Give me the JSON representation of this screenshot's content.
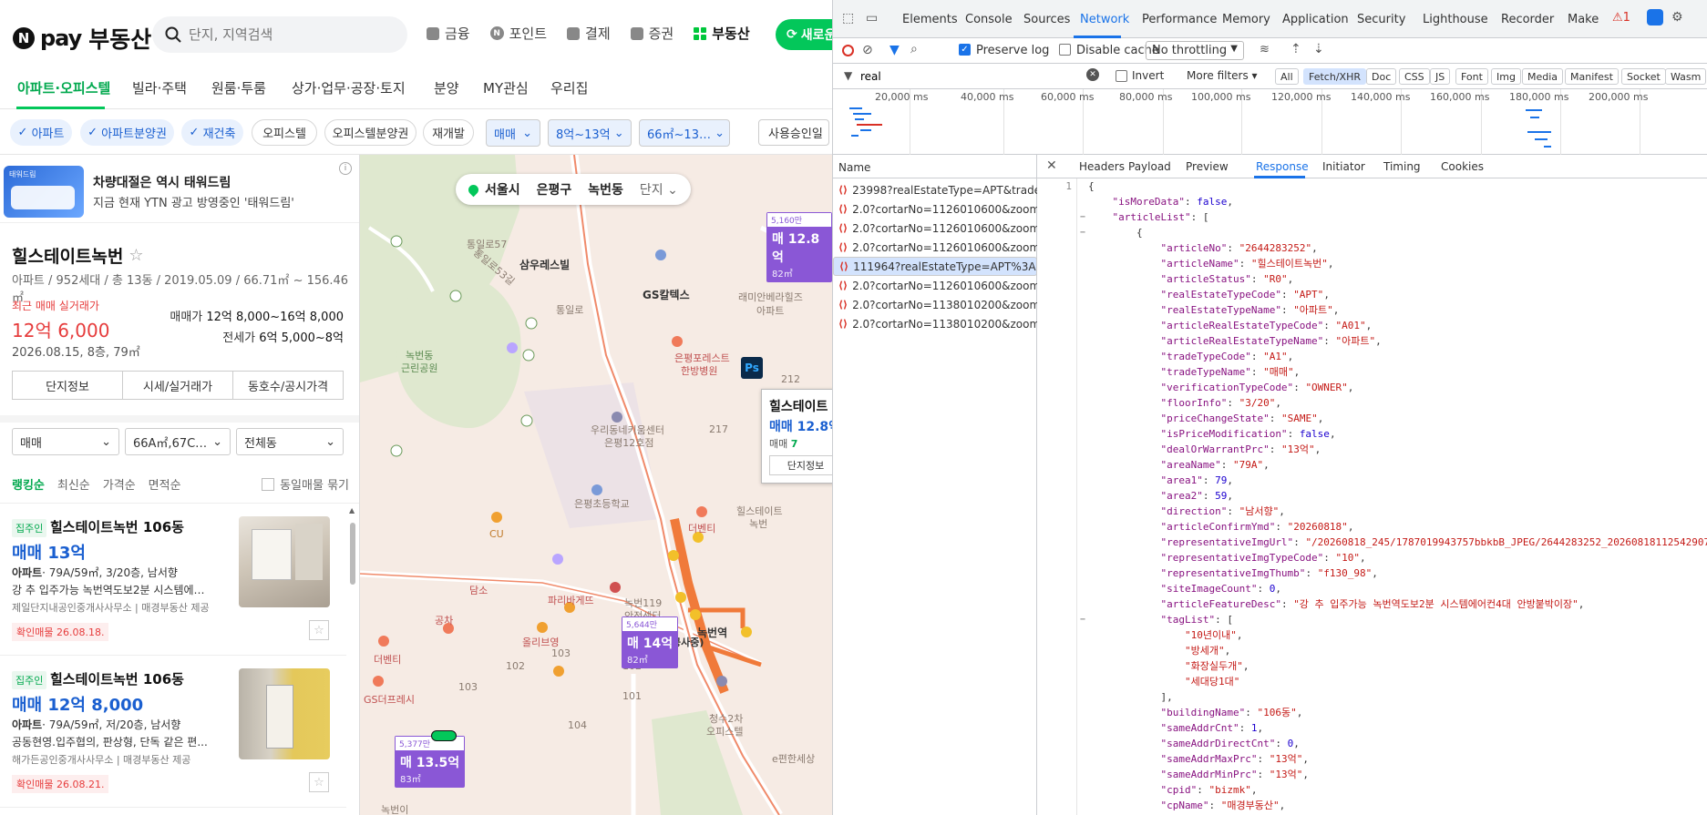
{
  "header": {
    "logo_pay": "pay",
    "logo_re": "부동산",
    "search_placeholder": "단지, 지역검색",
    "nav": [
      "금융",
      "포인트",
      "결제",
      "증권",
      "부동산"
    ],
    "new_btn": "새로운"
  },
  "subnav": [
    "아파트·오피스텔",
    "빌라·주택",
    "원룸·투룸",
    "상가·업무·공장·토지",
    "분양",
    "MY관심",
    "우리집"
  ],
  "filters": {
    "chips_on": [
      "아파트",
      "아파트분양권",
      "재건축"
    ],
    "chips_off": [
      "오피스텔",
      "오피스텔분양권",
      "재개발"
    ],
    "trade": "매매",
    "price": "8억~13억",
    "area": "66㎡~13…",
    "approval": "사용승인일"
  },
  "ad": {
    "title": "차량대절은 역시 태워드림",
    "text": "지금 현재 YTN 광고 방영중인 '태워드림'",
    "info": "i",
    "thumb": "태워드림"
  },
  "complex": {
    "name": "힐스테이트녹번",
    "meta": "아파트 / 952세대 / 총 13동 / 2019.05.09 / 66.71㎡ ~ 156.46㎡",
    "recent_label": "최근 매매 실거래가",
    "recent_price": "12억 6,000",
    "recent_date": "2026.08.15, 8층, 79㎡",
    "sale_label": "매매가",
    "sale_range": "12억 8,000~16억 8,000",
    "jeonse_label": "전세가",
    "jeonse_range": "6억 5,000~8억",
    "tabs": [
      "단지정보",
      "시세/실거래가",
      "동호수/공시가격"
    ]
  },
  "list_filters": {
    "trade": "매매",
    "area": "66A㎡,67C…",
    "dong": "전체동"
  },
  "sort": {
    "items": [
      "랭킹순",
      "최신순",
      "가격순",
      "면적순"
    ],
    "same_group": "동일매물 묶기"
  },
  "listings": [
    {
      "badge": "집주인",
      "title": "힐스테이트녹번 106동",
      "price": "매매 13억",
      "type": "아파트",
      "spec": "· 79A/59㎡, 3/20층, 남서향",
      "desc": "강 추 입주가능 녹번역도보2분 시스템에어...",
      "agent1": "제일단지내공인중개사사무소",
      "agent2": "매경부동산 제공",
      "confirm": "확인매물 26.08.18."
    },
    {
      "badge": "집주인",
      "title": "힐스테이트녹번 106동",
      "price": "매매 12억 8,000",
      "type": "아파트",
      "spec": "· 79A/59㎡, 저/20층, 남서향",
      "desc": "공동현영.입주협의, 판상형, 단독 같은 편...",
      "agent1": "해가든공인중개사사무소",
      "agent2": "매경부동산 제공",
      "confirm": "확인매물 26.08.21."
    }
  ],
  "map": {
    "loc": [
      "서울시",
      "은평구",
      "녹번동",
      "단지"
    ],
    "markers": [
      {
        "top": "5,160만",
        "price": "매 12.8억",
        "area": "82㎡"
      },
      {
        "top": "5,644만",
        "price": "매 14억",
        "area": "82㎡"
      },
      {
        "top": "5,377만",
        "price": "매 13.5억",
        "area": "83㎡"
      }
    ],
    "labels": [
      "통일로57",
      "삼우레스빌",
      "통일로",
      "GS칼텍스",
      "래미안베라힐즈",
      "아파트",
      "녹번동",
      "근린공원",
      "은평포레스트",
      "한방병원",
      "우리동네키움센터",
      "은평12호점",
      "은평초등학교",
      "CU",
      "힐스테이트",
      "녹번",
      "더벤티",
      "담소",
      "파리바게뜨",
      "녹번119",
      "안전센터",
      "녹번역",
      "(공사중)",
      "공차",
      "올리브영",
      "더벤티",
      "GS더프레시",
      "청수2차",
      "오피스텔",
      "녹번이",
      "e편한세상",
      "통일로53길",
      "217",
      "212",
      "212",
      "103",
      "103",
      "102",
      "101",
      "104",
      "102"
    ],
    "popup": {
      "title": "힐스테이트",
      "price": "매매 12.8억",
      "count_label": "매매",
      "count": "7",
      "btn": "단지정보"
    },
    "ps": "Ps"
  },
  "devtools": {
    "tabs": [
      "Elements",
      "Console",
      "Sources",
      "Network",
      "Performance",
      "Memory",
      "Application",
      "Security",
      "Lighthouse",
      "Recorder",
      "Make"
    ],
    "warn": "1",
    "toolbar": {
      "preserve": "Preserve log",
      "disable": "Disable cache",
      "throttle": "No throttling"
    },
    "filter": {
      "value": "real",
      "invert": "Invert",
      "more": "More filters",
      "types": [
        "All",
        "Fetch/XHR",
        "Doc",
        "CSS",
        "JS",
        "Font",
        "Img",
        "Media",
        "Manifest",
        "Socket",
        "Wasm"
      ]
    },
    "timeline": [
      "20,000 ms",
      "40,000 ms",
      "60,000 ms",
      "80,000 ms",
      "100,000 ms",
      "120,000 ms",
      "140,000 ms",
      "160,000 ms",
      "180,000 ms",
      "200,000 ms"
    ],
    "name_header": "Name",
    "requests": [
      "23998?realEstateType=APT&trade...",
      "2.0?cortarNo=1126010600&zoom...",
      "2.0?cortarNo=1126010600&zoom...",
      "2.0?cortarNo=1126010600&zoom...",
      "111964?realEstateType=APT%3AA...",
      "2.0?cortarNo=1126010600&zoom...",
      "2.0?cortarNo=1138010200&zoom...",
      "2.0?cortarNo=1138010200&zoom..."
    ],
    "detail_tabs": [
      "Headers",
      "Payload",
      "Preview",
      "Response",
      "Initiator",
      "Timing",
      "Cookies"
    ],
    "lines": [
      "{",
      "    \"isMoreData\": false,",
      "    \"articleList\": [",
      "        {",
      "            \"articleNo\": \"2644283252\",",
      "            \"articleName\": \"힐스테이트녹번\",",
      "            \"articleStatus\": \"R0\",",
      "            \"realEstateTypeCode\": \"APT\",",
      "            \"realEstateTypeName\": \"아파트\",",
      "            \"articleRealEstateTypeCode\": \"A01\",",
      "            \"articleRealEstateTypeName\": \"아파트\",",
      "            \"tradeTypeCode\": \"A1\",",
      "            \"tradeTypeName\": \"매매\",",
      "            \"verificationTypeCode\": \"OWNER\",",
      "            \"floorInfo\": \"3/20\",",
      "            \"priceChangeState\": \"SAME\",",
      "            \"isPriceModification\": false,",
      "            \"dealOrWarrantPrc\": \"13억\",",
      "            \"areaName\": \"79A\",",
      "            \"area1\": 79,",
      "            \"area2\": 59,",
      "            \"direction\": \"남서향\",",
      "            \"articleConfirmYmd\": \"20260818\",",
      "            \"representativeImgUrl\": \"/20260818_245/1787019943757bbkbB_JPEG/2644283252_20260818112542907812.jpg\",",
      "            \"representativeImgTypeCode\": \"10\",",
      "            \"representativeImgThumb\": \"f130_98\",",
      "            \"siteImageCount\": 0,",
      "            \"articleFeatureDesc\": \"강 추 입주가능 녹번역도보2분 시스템에어컨4대 안방붙박이장\",",
      "            \"tagList\": [",
      "                \"10년이내\",",
      "                \"방세개\",",
      "                \"화장실두개\",",
      "                \"세대당1대\"",
      "            ],",
      "            \"buildingName\": \"106동\",",
      "            \"sameAddrCnt\": 1,",
      "            \"sameAddrDirectCnt\": 0,",
      "            \"sameAddrMaxPrc\": \"13억\",",
      "            \"sameAddrMinPrc\": \"13억\",",
      "            \"cpid\": \"bizmk\",",
      "            \"cpName\": \"매경부동산\",",
      "            \"cpPcArticleUrl\": \"http://land.mk.co.kr/rd/rd.php?UID=2644283252\","
    ],
    "line_no": "1",
    "colors": {
      "accent": "#1a73e8",
      "naver_green": "#03c75a",
      "marker": "#8a57d6"
    }
  }
}
